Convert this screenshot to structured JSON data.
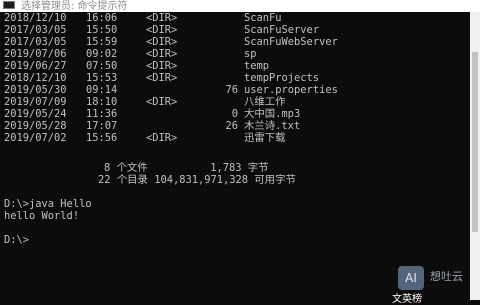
{
  "window": {
    "title": "选择管理员: 命令提示符"
  },
  "listing": [
    {
      "date": "2018/12/10",
      "time": "16:06",
      "type": "<DIR>",
      "size": "",
      "name": "ScanFu"
    },
    {
      "date": "2017/03/05",
      "time": "15:50",
      "type": "<DIR>",
      "size": "",
      "name": "ScanFuServer"
    },
    {
      "date": "2017/03/05",
      "time": "15:59",
      "type": "<DIR>",
      "size": "",
      "name": "ScanFuWebServer"
    },
    {
      "date": "2019/07/06",
      "time": "09:02",
      "type": "<DIR>",
      "size": "",
      "name": "sp"
    },
    {
      "date": "2019/06/27",
      "time": "07:50",
      "type": "<DIR>",
      "size": "",
      "name": "temp"
    },
    {
      "date": "2018/12/10",
      "time": "15:53",
      "type": "<DIR>",
      "size": "",
      "name": "tempProjects"
    },
    {
      "date": "2019/05/30",
      "time": "09:14",
      "type": "",
      "size": "76",
      "name": "user.properties"
    },
    {
      "date": "2019/07/09",
      "time": "18:10",
      "type": "<DIR>",
      "size": "",
      "name": "八维工作"
    },
    {
      "date": "2019/05/24",
      "time": "11:36",
      "type": "",
      "size": "0",
      "name": "大中国.mp3"
    },
    {
      "date": "2019/05/28",
      "time": "17:07",
      "type": "",
      "size": "26",
      "name": "木兰诗.txt"
    },
    {
      "date": "2019/07/02",
      "time": "15:56",
      "type": "<DIR>",
      "size": "",
      "name": "迅雷下载"
    }
  ],
  "summary": {
    "files_line": "8 个文件          1,783 字节",
    "dirs_line": "22 个目录 104,831,971,328 可用字节"
  },
  "session": {
    "cmd1": "D:\\>java Hello",
    "output": "hello World!",
    "prompt": "D:\\>"
  },
  "overlay": {
    "watermark_logo": "AI",
    "watermark_text": "想吐云",
    "ime_text": "文英榜"
  }
}
